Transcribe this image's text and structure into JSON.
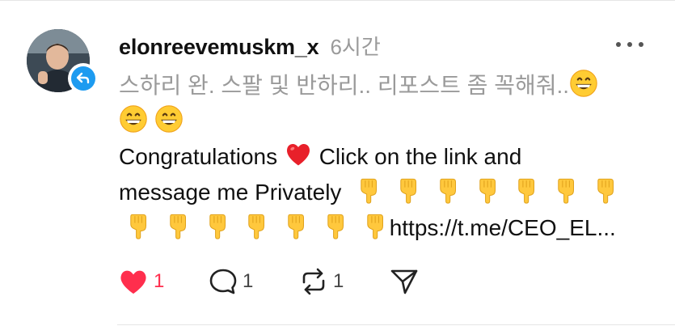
{
  "post": {
    "username": "elonreevemuskm_x",
    "timestamp": "6시간",
    "korean_line1": "스하리 완. 스팔 및 반하리.. 리포스트 좀 꼭해줘..",
    "congrats_text": "Congratulations",
    "click_text": "Click on the link and",
    "message_text": "message me Privately",
    "link_text": "https://t.me/CEO_EL..."
  },
  "actions": {
    "like_count": "1",
    "reply_count": "1",
    "repost_count": "1"
  },
  "icons": {
    "more": "more-horizontal-icon",
    "follow": "follow-arrow-icon",
    "like": "heart-icon",
    "reply": "comment-icon",
    "repost": "repost-icon",
    "share": "send-icon",
    "grin": "grinning-emoji",
    "heart_emoji": "red-heart-emoji",
    "point_down": "point-down-emoji"
  },
  "colors": {
    "like_active": "#ff2e4d",
    "muted": "#9a9a9a",
    "badge": "#1d9bf0"
  }
}
